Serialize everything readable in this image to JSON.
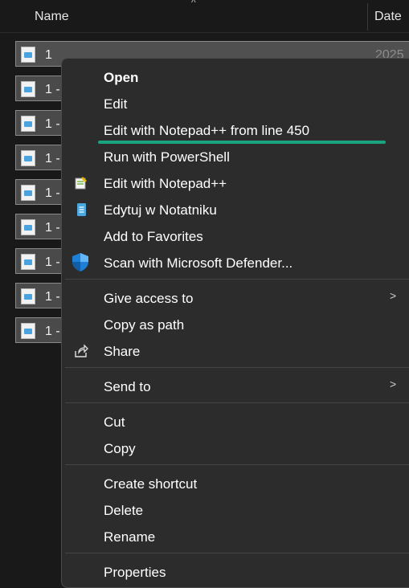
{
  "header": {
    "name_col": "Name",
    "date_col": "Date",
    "sort_caret": "^"
  },
  "files": [
    {
      "name": "1",
      "date": "2025"
    },
    {
      "name": "1 -"
    },
    {
      "name": "1 -"
    },
    {
      "name": "1 -"
    },
    {
      "name": "1 -"
    },
    {
      "name": "1 -"
    },
    {
      "name": "1 -"
    },
    {
      "name": "1 -"
    },
    {
      "name": "1 -"
    }
  ],
  "menu": {
    "open": "Open",
    "edit": "Edit",
    "edit_npp_line": "Edit with Notepad++ from line 450",
    "run_powershell": "Run with PowerShell",
    "edit_npp": "Edit with Notepad++",
    "edit_notepad": "Edytuj w Notatniku",
    "add_favorites": "Add to Favorites",
    "scan_defender": "Scan with Microsoft Defender...",
    "give_access": "Give access to",
    "copy_path": "Copy as path",
    "share": "Share",
    "send_to": "Send to",
    "cut": "Cut",
    "copy": "Copy",
    "create_shortcut": "Create shortcut",
    "delete": "Delete",
    "rename": "Rename",
    "properties": "Properties",
    "chevron": ">"
  },
  "colors": {
    "highlight_underline": "#1aa37f",
    "menu_bg": "#2c2c2c"
  }
}
